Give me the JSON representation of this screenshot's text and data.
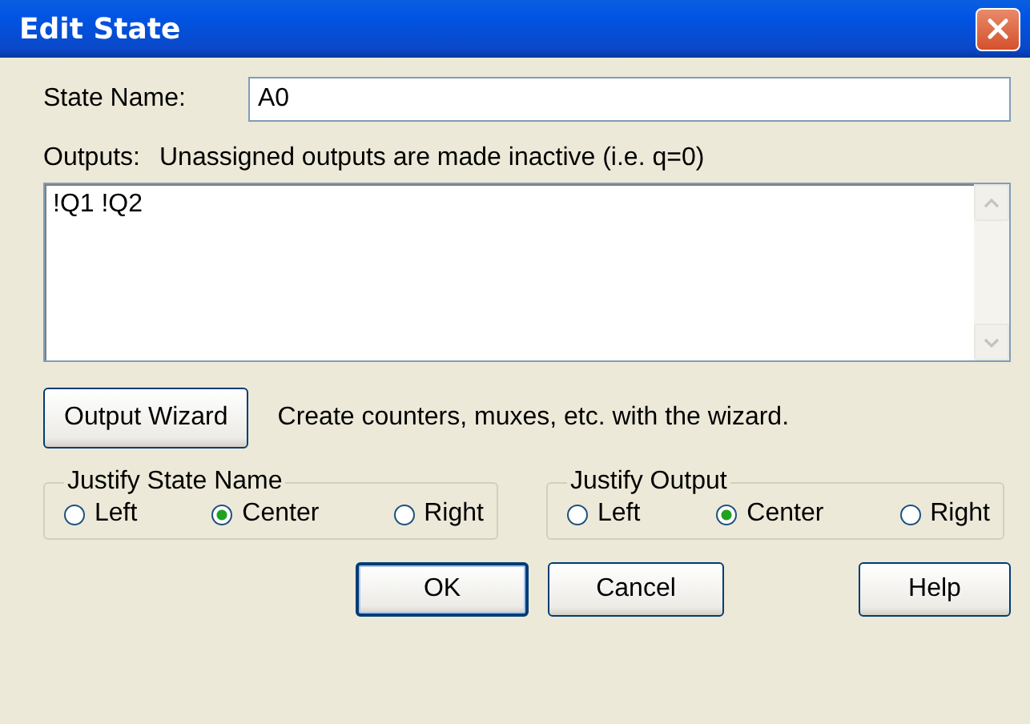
{
  "window": {
    "title": "Edit State"
  },
  "state_name": {
    "label": "State Name:",
    "value": "A0"
  },
  "outputs": {
    "label": "Outputs:",
    "note": "Unassigned outputs are made inactive (i.e. q=0)",
    "value": "!Q1 !Q2"
  },
  "wizard": {
    "button": "Output Wizard",
    "description": "Create counters, muxes, etc. with the wizard."
  },
  "groups": [
    {
      "title": "Justify State Name",
      "options": [
        {
          "label": "Left",
          "selected": false
        },
        {
          "label": "Center",
          "selected": true
        },
        {
          "label": "Right",
          "selected": false
        }
      ]
    },
    {
      "title": "Justify Output",
      "options": [
        {
          "label": "Left",
          "selected": false
        },
        {
          "label": "Center",
          "selected": true
        },
        {
          "label": "Right",
          "selected": false
        }
      ]
    }
  ],
  "buttons": [
    {
      "label": "OK",
      "default": true
    },
    {
      "label": "Cancel",
      "default": false
    },
    {
      "label": "Help",
      "default": false
    }
  ]
}
